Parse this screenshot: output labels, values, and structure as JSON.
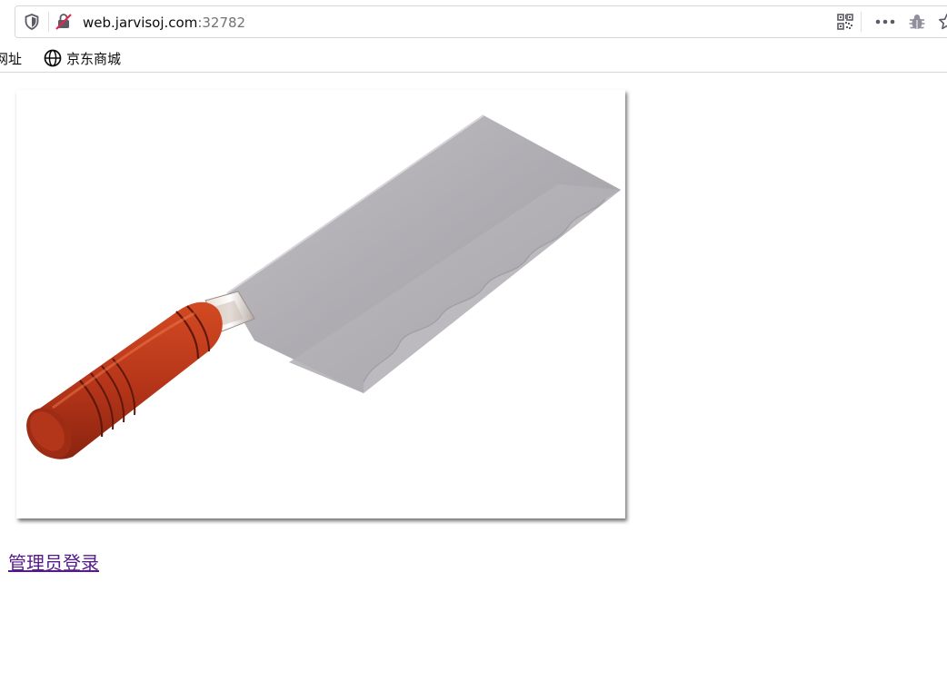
{
  "browser": {
    "url_host": "web.jarvisoj.com",
    "url_port": ":32782",
    "icons": {
      "tracking": "shield-icon",
      "connection": "insecure-connection-icon",
      "qr": "qr-code-icon",
      "more": "more-actions-icon",
      "extension": "bug-extension-icon",
      "bookmark": "star-icon"
    }
  },
  "bookmarks": {
    "items": [
      {
        "label": "网址",
        "icon": ""
      },
      {
        "label": "京东商城",
        "icon": "globe-icon"
      }
    ]
  },
  "page": {
    "image": {
      "subject": "cleaver knife with red wooden handle"
    },
    "admin_login_link": "管理员登录"
  },
  "colors": {
    "link_visited": "#551a8b",
    "handle_red": "#b8361a",
    "blade_gray": "#a8a6ab"
  }
}
